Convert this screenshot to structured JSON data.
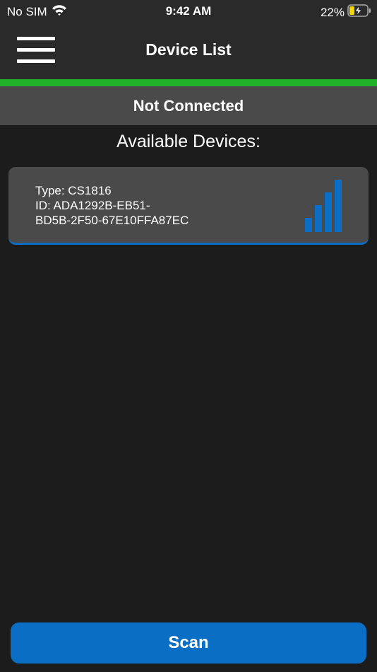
{
  "status_bar": {
    "carrier": "No SIM",
    "time": "9:42 AM",
    "battery_percent": "22%",
    "wifi_icon": "wifi-icon",
    "battery_icon": "battery-charging-icon"
  },
  "nav": {
    "title": "Device List",
    "menu_icon": "hamburger-menu-icon"
  },
  "connection": {
    "status": "Not Connected"
  },
  "devices": {
    "heading": "Available Devices:",
    "items": [
      {
        "type_line": "Type: CS1816",
        "id_line1": "ID: ADA1292B-EB51-",
        "id_line2": "BD5B-2F50-67E10FFA87EC",
        "signal_bars": 4,
        "signal_icon": "signal-strength-icon"
      }
    ]
  },
  "actions": {
    "scan_label": "Scan"
  },
  "colors": {
    "accent_blue": "#0a6ec4",
    "status_green": "#22b22a",
    "card_gray": "#4a4a4a",
    "background": "#1c1c1c"
  }
}
